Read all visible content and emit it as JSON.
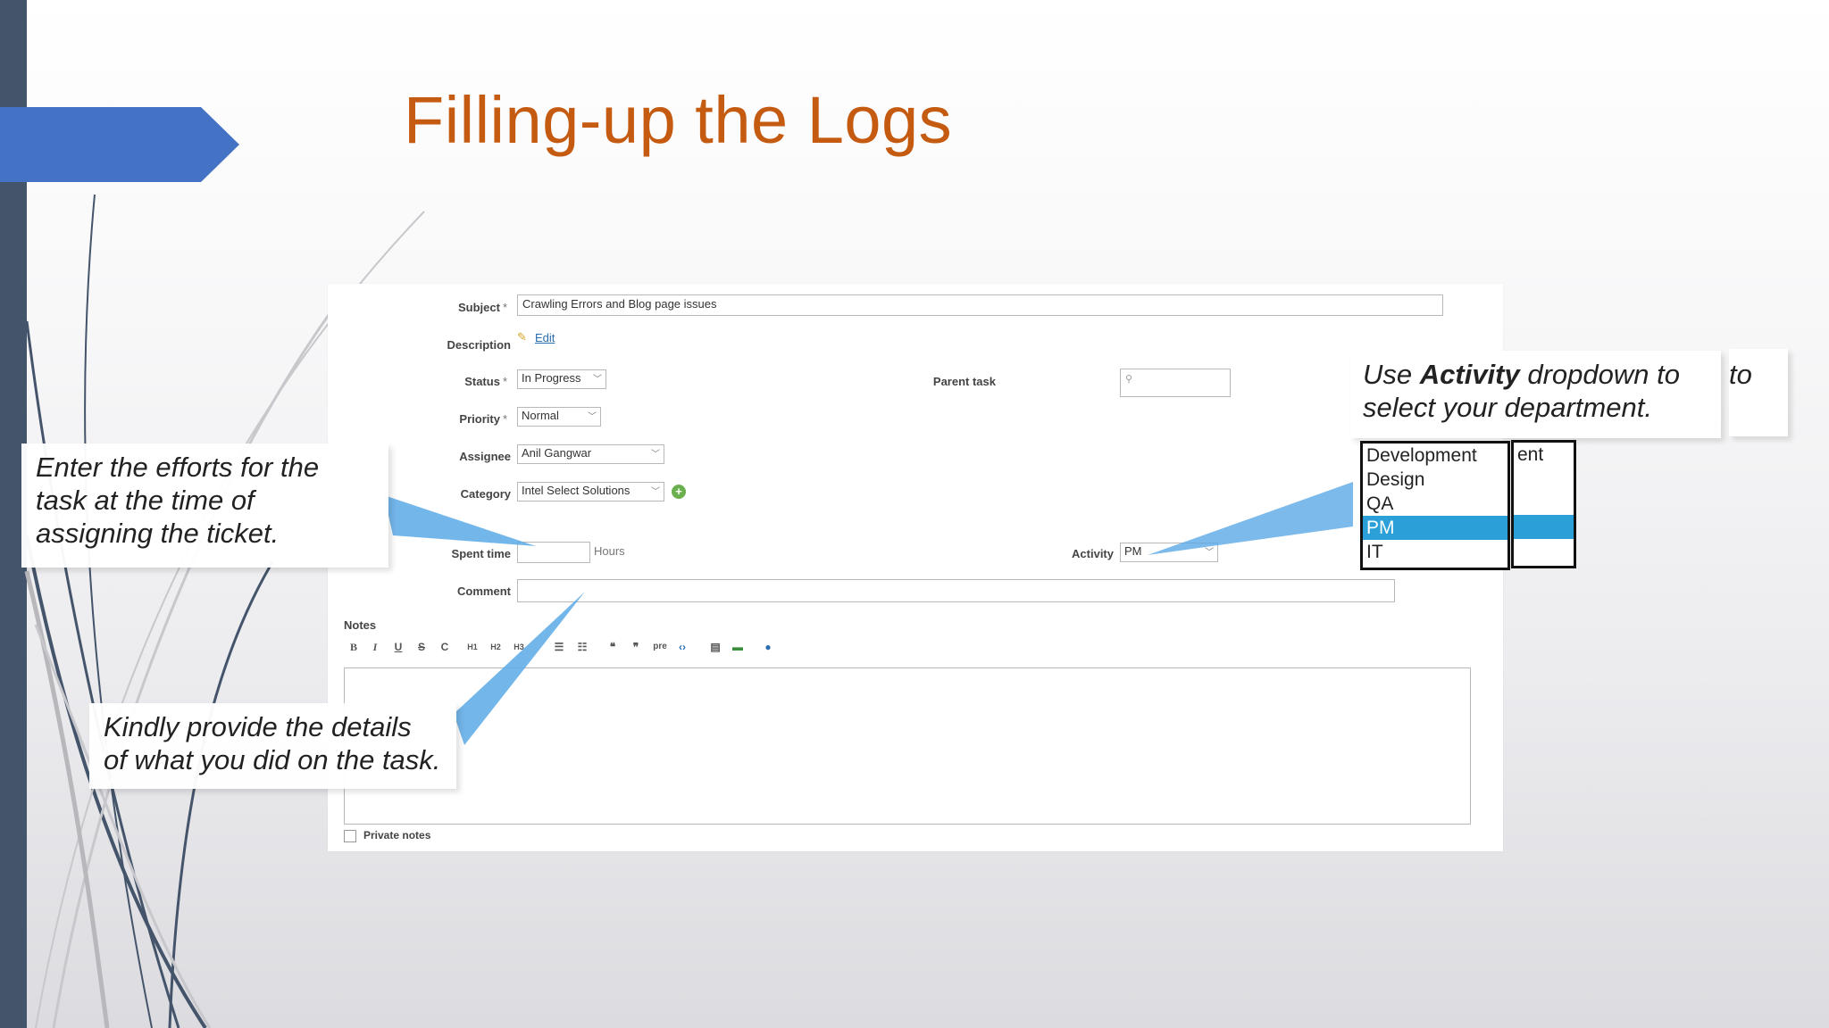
{
  "slide": {
    "title": "Filling-up the Logs"
  },
  "form": {
    "subject": {
      "label": "Subject",
      "required_mark": "*",
      "value": "Crawling Errors and Blog page issues"
    },
    "description": {
      "label": "Description",
      "edit_link": "Edit"
    },
    "status": {
      "label": "Status",
      "required_mark": "*",
      "value": "In Progress"
    },
    "parent_task": {
      "label": "Parent task",
      "value": ""
    },
    "priority": {
      "label": "Priority",
      "required_mark": "*",
      "value": "Normal"
    },
    "assignee": {
      "label": "Assignee",
      "value": "Anil Gangwar"
    },
    "category": {
      "label": "Category",
      "value": "Intel Select Solutions"
    },
    "spent_time": {
      "label": "Spent time",
      "value": "",
      "unit": "Hours"
    },
    "activity": {
      "label": "Activity",
      "value": "PM"
    },
    "comment": {
      "label": "Comment",
      "value": ""
    },
    "notes": {
      "label": "Notes",
      "toolbar": [
        "B",
        "I",
        "U",
        "S",
        "C",
        "H1",
        "H2",
        "H3",
        "ul",
        "ol",
        "bq",
        "unbq",
        "pre",
        "code",
        "img",
        "img2",
        "help"
      ],
      "private_notes_label": "Private notes"
    }
  },
  "callouts": {
    "activity_tip": {
      "prefix": "Use ",
      "bold": "Activity",
      "suffix": " dropdown to select your department.",
      "overflow_text": "to"
    },
    "effort_tip": "Enter the efforts for the task at the time of assigning the ticket.",
    "details_tip": "Kindly provide the details of what you did on the task."
  },
  "activity_dropdown": {
    "options": [
      "Development",
      "Design",
      "QA",
      "PM",
      "IT"
    ],
    "selected": "PM",
    "behind_text": "ent"
  },
  "colors": {
    "title": "#c55a11",
    "left_bar": "#44546a",
    "arrow_tab": "#4472c4",
    "selected_option": "#2a9fd8",
    "pointer": "#5aa9e6"
  }
}
